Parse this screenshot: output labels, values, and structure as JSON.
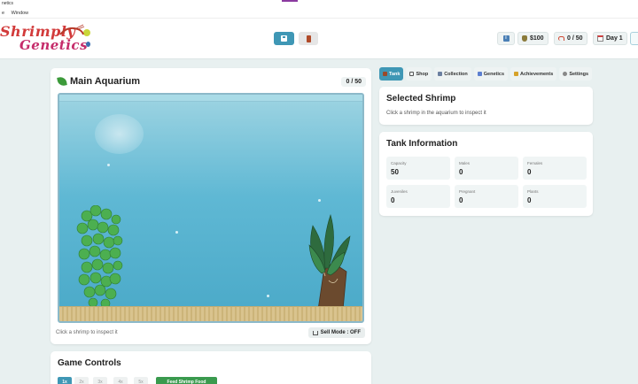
{
  "os": {
    "title": "netics",
    "menu": [
      "e",
      "Window"
    ]
  },
  "header": {
    "logo_line1": "Shrimply",
    "logo_line2": "Genetics",
    "money": "$100",
    "population": "0 / 50",
    "day": "Day 1"
  },
  "aquarium": {
    "title": "Main Aquarium",
    "count": "0 / 50",
    "hint": "Click a shrimp to inspect it",
    "sell_mode": "Sell Mode : OFF"
  },
  "controls": {
    "title": "Game Controls",
    "speeds": [
      "1x",
      "2x",
      "3x",
      "4x",
      "5x"
    ],
    "feed_label": "Feed Shrimp Food"
  },
  "tabs": [
    "Tank",
    "Shop",
    "Collection",
    "Genetics",
    "Achievements",
    "Settings"
  ],
  "selected": {
    "title": "Selected Shrimp",
    "text": "Click a shrimp in the aquarium to inspect it"
  },
  "tank_info": {
    "title": "Tank Information",
    "stats": [
      {
        "label": "Capacity",
        "value": "50"
      },
      {
        "label": "Males",
        "value": "0"
      },
      {
        "label": "Females",
        "value": "0"
      },
      {
        "label": "Juveniles",
        "value": "0"
      },
      {
        "label": "Pregnant",
        "value": "0"
      },
      {
        "label": "Plants",
        "value": "0"
      }
    ]
  },
  "colors": {
    "accent": "#3f97b5",
    "feed": "#3a9a4e",
    "water": "#5fb8d4"
  }
}
